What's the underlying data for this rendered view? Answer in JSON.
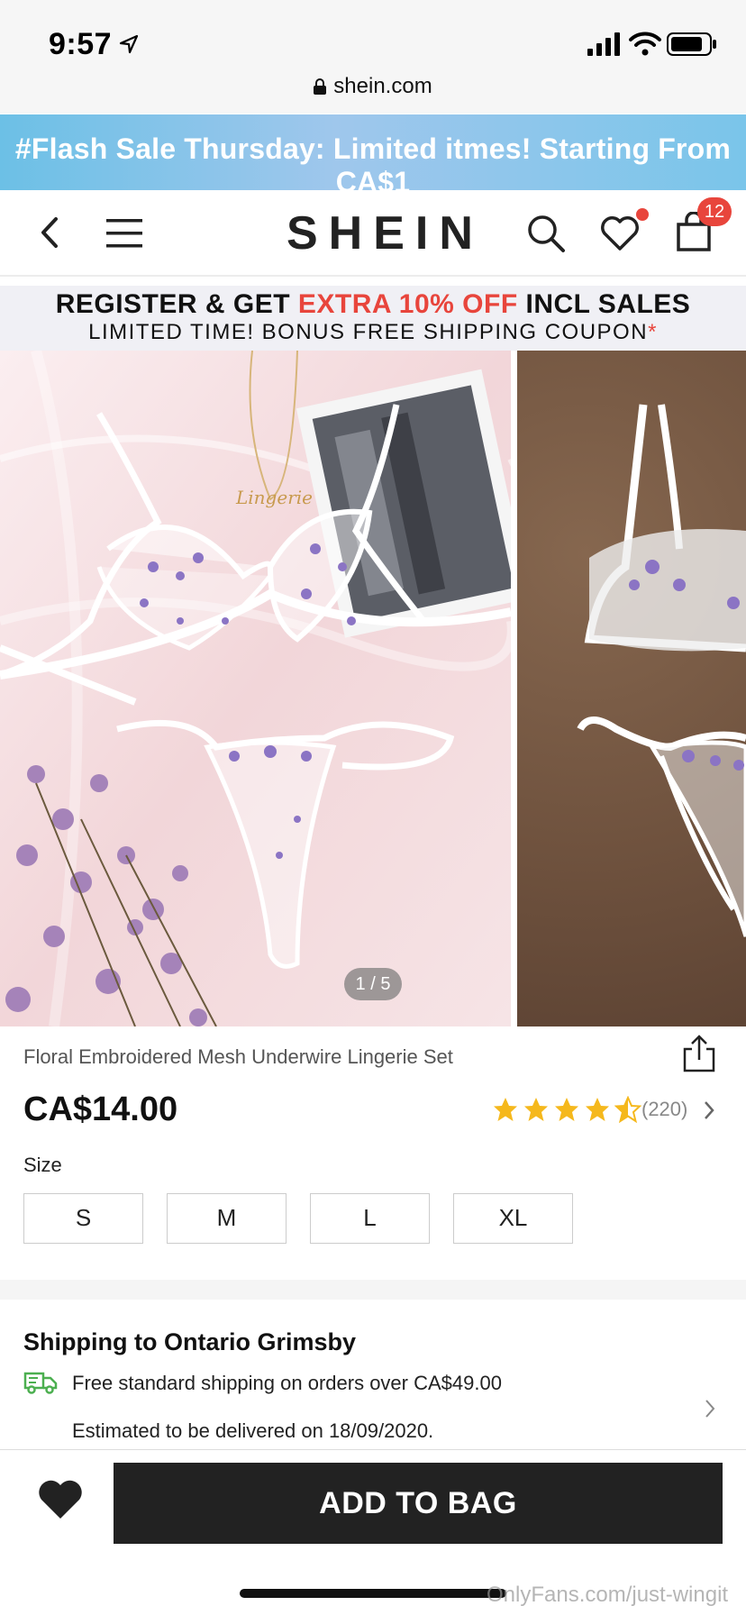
{
  "status_bar": {
    "time": "9:57"
  },
  "browser": {
    "url": "shein.com"
  },
  "flash_banner": {
    "text": "#Flash Sale Thursday: Limited itmes! Starting From CA$1"
  },
  "nav": {
    "logo": "SHEIN",
    "cart_count": "12"
  },
  "register_banner": {
    "line1_a": "REGISTER & GET ",
    "line1_red": "EXTRA 10% OFF",
    "line1_b": " INCL SALES",
    "line2": "LIMITED TIME! BONUS FREE SHIPPING COUPON",
    "line2_mark": "*"
  },
  "gallery": {
    "pager": "1 / 5",
    "current_image": 1,
    "total_images": 5
  },
  "product": {
    "title": "Floral Embroidered Mesh Underwire Lingerie Set",
    "price": "CA$14.00",
    "rating": 4.5,
    "rating_count": "(220)",
    "star_color": "#f5b81c"
  },
  "size": {
    "label": "Size",
    "options": [
      "S",
      "M",
      "L",
      "XL"
    ]
  },
  "shipping": {
    "title": "Shipping to Ontario Grimsby",
    "free_text": "Free standard shipping on orders over CA$49.00",
    "estimate": "Estimated to be delivered on 18/09/2020."
  },
  "actions": {
    "add_to_bag": "ADD TO BAG"
  },
  "watermark": "OnlyFans.com/just-wingit",
  "colors": {
    "accent_red": "#e8453c",
    "flash_blue": "#6cc0e6",
    "button_dark": "#222222",
    "truck_green": "#4caf50"
  },
  "icons": [
    "location-arrow-icon",
    "signal-icon",
    "wifi-icon",
    "battery-icon",
    "lock-icon",
    "back-icon",
    "menu-icon",
    "search-icon",
    "heart-icon",
    "bag-icon",
    "share-icon",
    "star-icon",
    "chevron-right-icon",
    "truck-icon",
    "heart-filled-icon"
  ]
}
